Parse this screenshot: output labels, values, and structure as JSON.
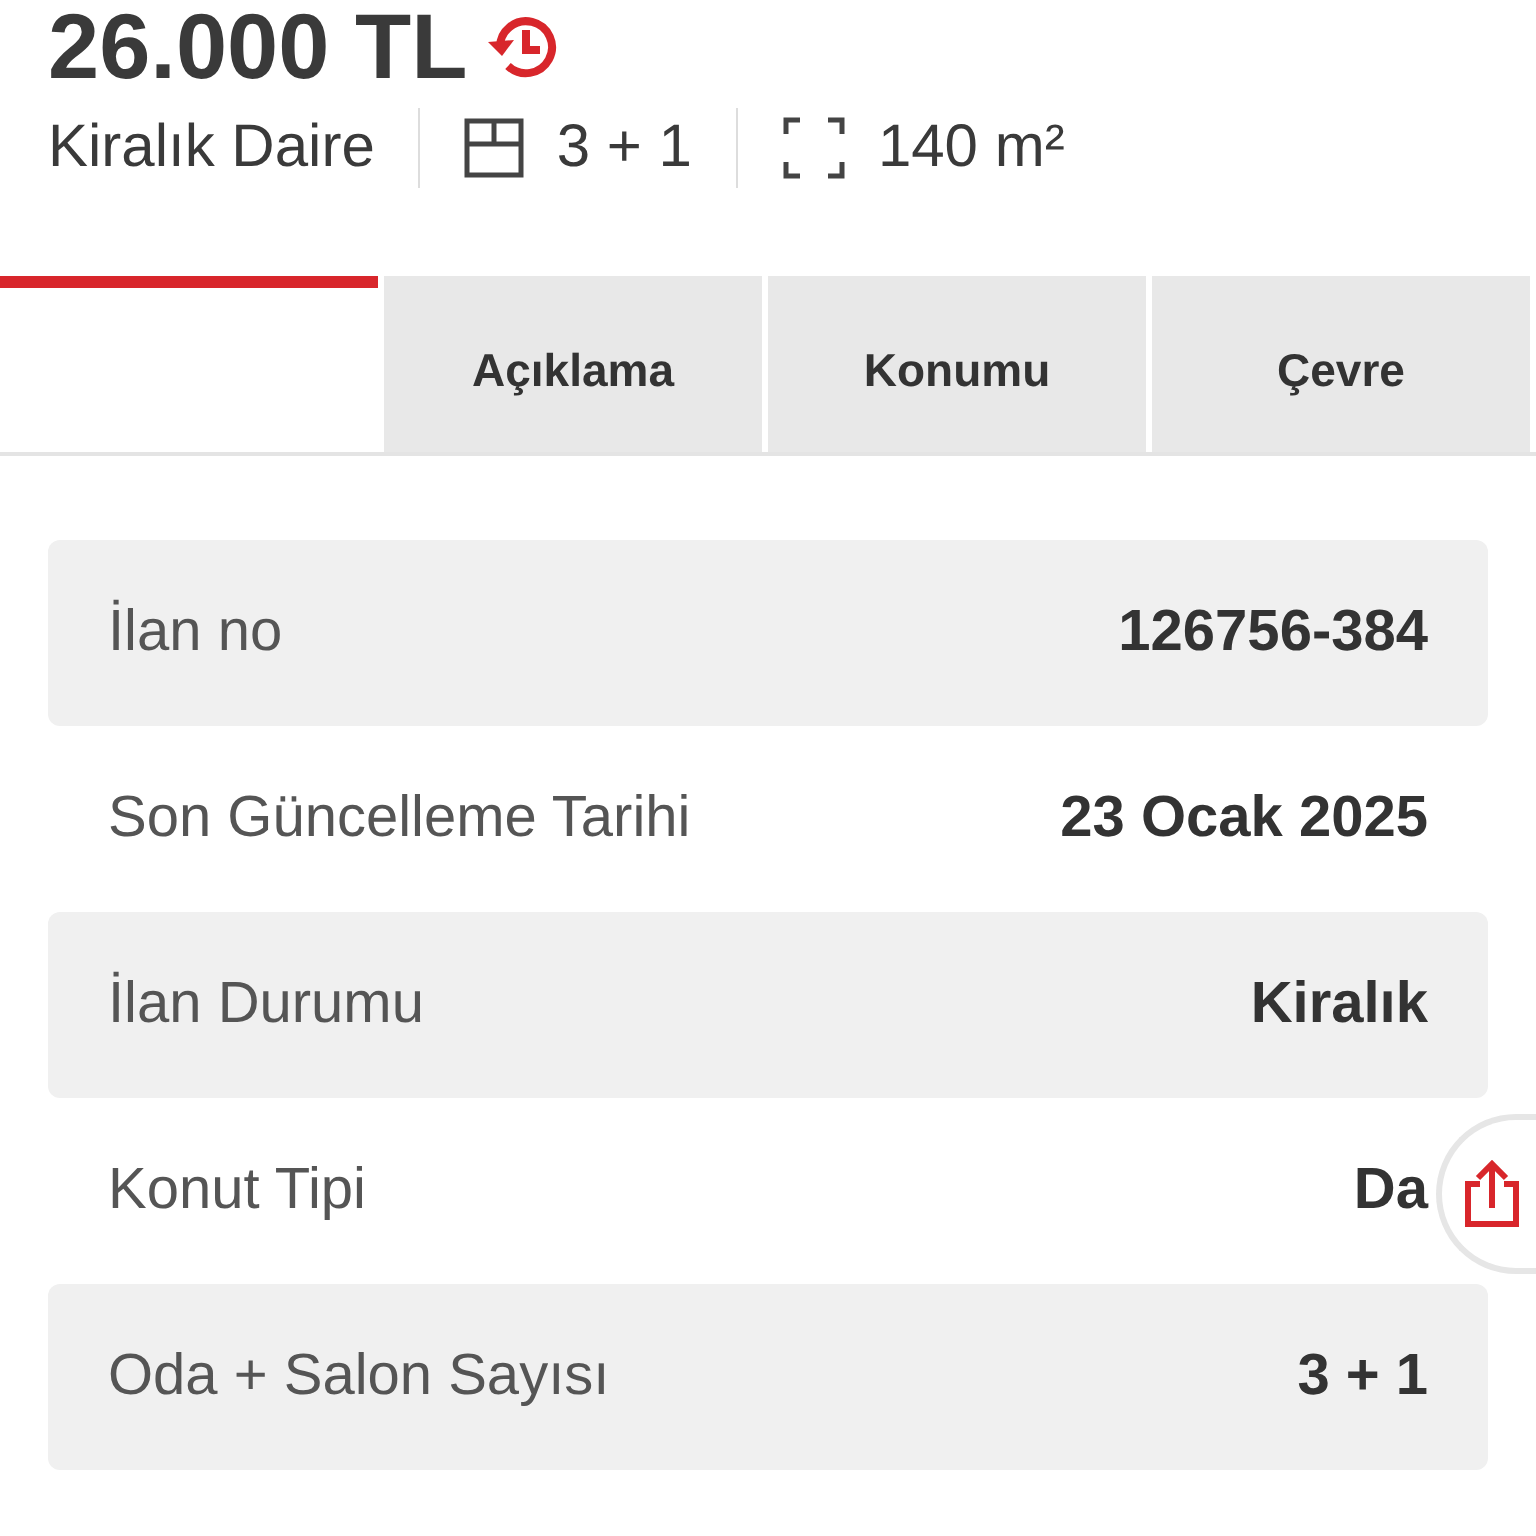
{
  "listing": {
    "price": "26.000 TL",
    "type": "Kiralık Daire",
    "rooms": "3 + 1",
    "area": "140 m²"
  },
  "tabs": [
    {
      "selected": true
    },
    {
      "label": "Açıklama",
      "selected": false
    },
    {
      "label": "Konumu",
      "selected": false
    },
    {
      "label": "Çevre",
      "selected": false
    }
  ],
  "details": [
    {
      "label": "İlan no",
      "value": "126756-384"
    },
    {
      "label": "Son Güncelleme Tarihi",
      "value": "23 Ocak 2025"
    },
    {
      "label": "İlan Durumu",
      "value": "Kiralık"
    },
    {
      "label": "Konut Tipi",
      "value": "Da"
    },
    {
      "label": "Oda + Salon Sayısı",
      "value": "3 + 1"
    }
  ]
}
